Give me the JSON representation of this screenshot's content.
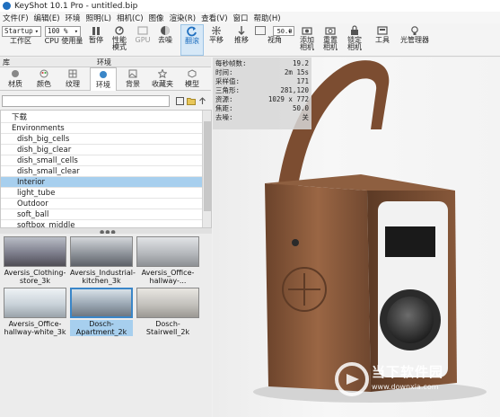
{
  "window": {
    "title": "KeyShot 10.1 Pro - untitled.bip"
  },
  "menu": [
    "文件(F)",
    "编辑(E)",
    "环境",
    "照明(L)",
    "相机(C)",
    "图像",
    "渲染(R)",
    "查看(V)",
    "窗口",
    "帮助(H)"
  ],
  "toolbar": {
    "workspace_value": "Startup",
    "zoom_value": "100 %",
    "fov_value": "50.0",
    "buttons": [
      {
        "label": "工作区"
      },
      {
        "label": "CPU 使用量"
      },
      {
        "label": "暂停"
      },
      {
        "label": "性能\n模式"
      },
      {
        "label": "GPU"
      },
      {
        "label": "去噪"
      },
      {
        "label": "翻滚"
      },
      {
        "label": "平移"
      },
      {
        "label": "推移"
      },
      {
        "label": "视角"
      },
      {
        "label": "添加\n相机"
      },
      {
        "label": "重置\n相机"
      },
      {
        "label": "锁定\n相机"
      },
      {
        "label": "工具"
      },
      {
        "label": "光管理器"
      }
    ]
  },
  "panel": {
    "header_left": "库",
    "header_center": "环境",
    "tabs": [
      {
        "label": "材质"
      },
      {
        "label": "颜色"
      },
      {
        "label": "纹理"
      },
      {
        "label": "环境"
      },
      {
        "label": "背景"
      },
      {
        "label": "收藏夹"
      },
      {
        "label": "模型"
      }
    ],
    "active_tab": "环境",
    "search_placeholder": ""
  },
  "tree": [
    {
      "label": "下载",
      "indent": 1,
      "selected": false
    },
    {
      "label": "Environments",
      "indent": 1,
      "selected": false
    },
    {
      "label": "dish_big_cells",
      "indent": 2,
      "selected": false
    },
    {
      "label": "dish_big_clear",
      "indent": 2,
      "selected": false
    },
    {
      "label": "dish_small_cells",
      "indent": 2,
      "selected": false
    },
    {
      "label": "dish_small_clear",
      "indent": 2,
      "selected": false
    },
    {
      "label": "Interior",
      "indent": 2,
      "selected": true
    },
    {
      "label": "light_tube",
      "indent": 2,
      "selected": false
    },
    {
      "label": "Outdoor",
      "indent": 2,
      "selected": false
    },
    {
      "label": "soft_ball",
      "indent": 2,
      "selected": false
    },
    {
      "label": "softbox_middle",
      "indent": 2,
      "selected": false
    }
  ],
  "thumbnails": [
    {
      "label": "Aversis_Clothing-\nstore_3k",
      "selected": false,
      "color": "#7d7e8c"
    },
    {
      "label": "Aversis_Industrial-\nkitchen_3k",
      "selected": false,
      "color": "#8a8f96"
    },
    {
      "label": "Aversis_Office-\nhallway-...",
      "selected": false,
      "color": "#b6b9bd"
    },
    {
      "label": "Aversis_Office-\nhallway-white_3k",
      "selected": false,
      "color": "#c9d2d9"
    },
    {
      "label": "Dosch-\nApartment_2k",
      "selected": true,
      "color": "#9aa7b3"
    },
    {
      "label": "Dosch-\nStairwell_2k",
      "selected": false,
      "color": "#c4c2bd"
    }
  ],
  "stats": [
    {
      "key": "每秒帧数:",
      "value": "19.2"
    },
    {
      "key": "时间:",
      "value": "2m 15s"
    },
    {
      "key": "采样值:",
      "value": "171"
    },
    {
      "key": "三角形:",
      "value": "281,120"
    },
    {
      "key": "资源:",
      "value": "1029 x 772"
    },
    {
      "key": "焦距:",
      "value": "50.0"
    },
    {
      "key": "去噪:",
      "value": "关"
    }
  ],
  "watermark": {
    "line1": "当下软件园",
    "line2": "www.downxia.com"
  },
  "colors": {
    "accent": "#1f6fbf",
    "selection": "#a7cfee",
    "leather": "#8a5a3c"
  }
}
